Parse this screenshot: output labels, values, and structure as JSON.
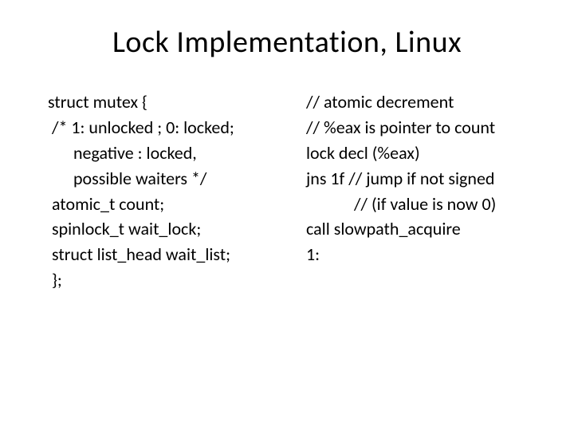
{
  "title": "Lock Implementation, Linux",
  "left": {
    "l1": "struct mutex {",
    "l2": " /* 1: unlocked ; 0: locked;",
    "l3": "negative : locked,",
    "l4": "possible waiters */",
    "l5": " atomic_t count;",
    "l6": " spinlock_t wait_lock;",
    "l7": " struct list_head wait_list;",
    "l8": " };"
  },
  "right": {
    "r1": "// atomic decrement",
    "r2": "// %eax is pointer to count",
    "r3": "lock decl (%eax)",
    "r4": "jns 1f // jump if not signed",
    "r5": "// (if value is now 0)",
    "r6": "call slowpath_acquire",
    "r7": "1:"
  }
}
